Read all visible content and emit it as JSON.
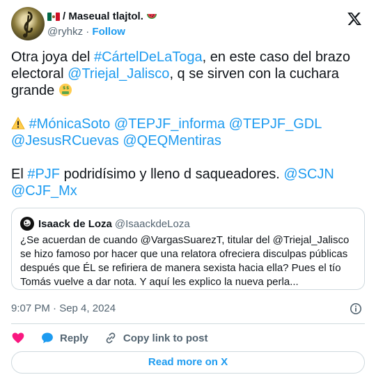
{
  "author": {
    "display_name": "/ Maseual tlajtol.",
    "handle": "@ryhkz",
    "separator": "·",
    "follow_label": "Follow",
    "flag_colors": [
      "#006847",
      "#ffffff",
      "#ce1126"
    ]
  },
  "tweet": {
    "para1": {
      "t1": "Otra joya del ",
      "hashtag1": "#CártelDeLaToga",
      "t2": ", en este caso del brazo electoral ",
      "mention1": "@Triejal_Jalisco",
      "t3": ", q se sirven con la cuchara grande "
    },
    "para2": {
      "hashtag": "#MónicaSoto",
      "m1": "@TEPJF_informa",
      "m2": "@TEPJF_GDL",
      "m3": "@JesusRCuevas",
      "m4": "@QEQMentiras"
    },
    "para3": {
      "t1": "El ",
      "hashtag": "#PJF",
      "t2": " podridísimo y lleno d saqueadores. ",
      "m1": "@SCJN",
      "m2": "@CJF_Mx"
    }
  },
  "quote": {
    "name": "Isaack de Loza",
    "handle": "@IsaackdeLoza",
    "text": "¿Se acuerdan de cuando @VargasSuarezT, titular del @Triejal_Jalisco se hizo famoso por hacer que una relatora ofreciera disculpas públicas después que ÉL se refiriera de manera sexista hacia ella? Pues el tío Tomás vuelve a dar nota. Y aquí les explico la nueva perla..."
  },
  "timestamp": "9:07 PM · Sep 4, 2024",
  "actions": {
    "reply": "Reply",
    "copy_link": "Copy link to post"
  },
  "read_more": "Read more on X",
  "colors": {
    "link": "#1d9bf0",
    "like": "#f91880",
    "text": "#0f1419",
    "muted": "#536471",
    "border": "#cfd9de"
  },
  "icons": [
    "x-logo-icon",
    "info-icon",
    "heart-icon",
    "reply-bubble-icon",
    "link-icon",
    "warning-icon",
    "money-mouth-face-icon",
    "watermelon-icon",
    "mexico-flag-icon"
  ]
}
